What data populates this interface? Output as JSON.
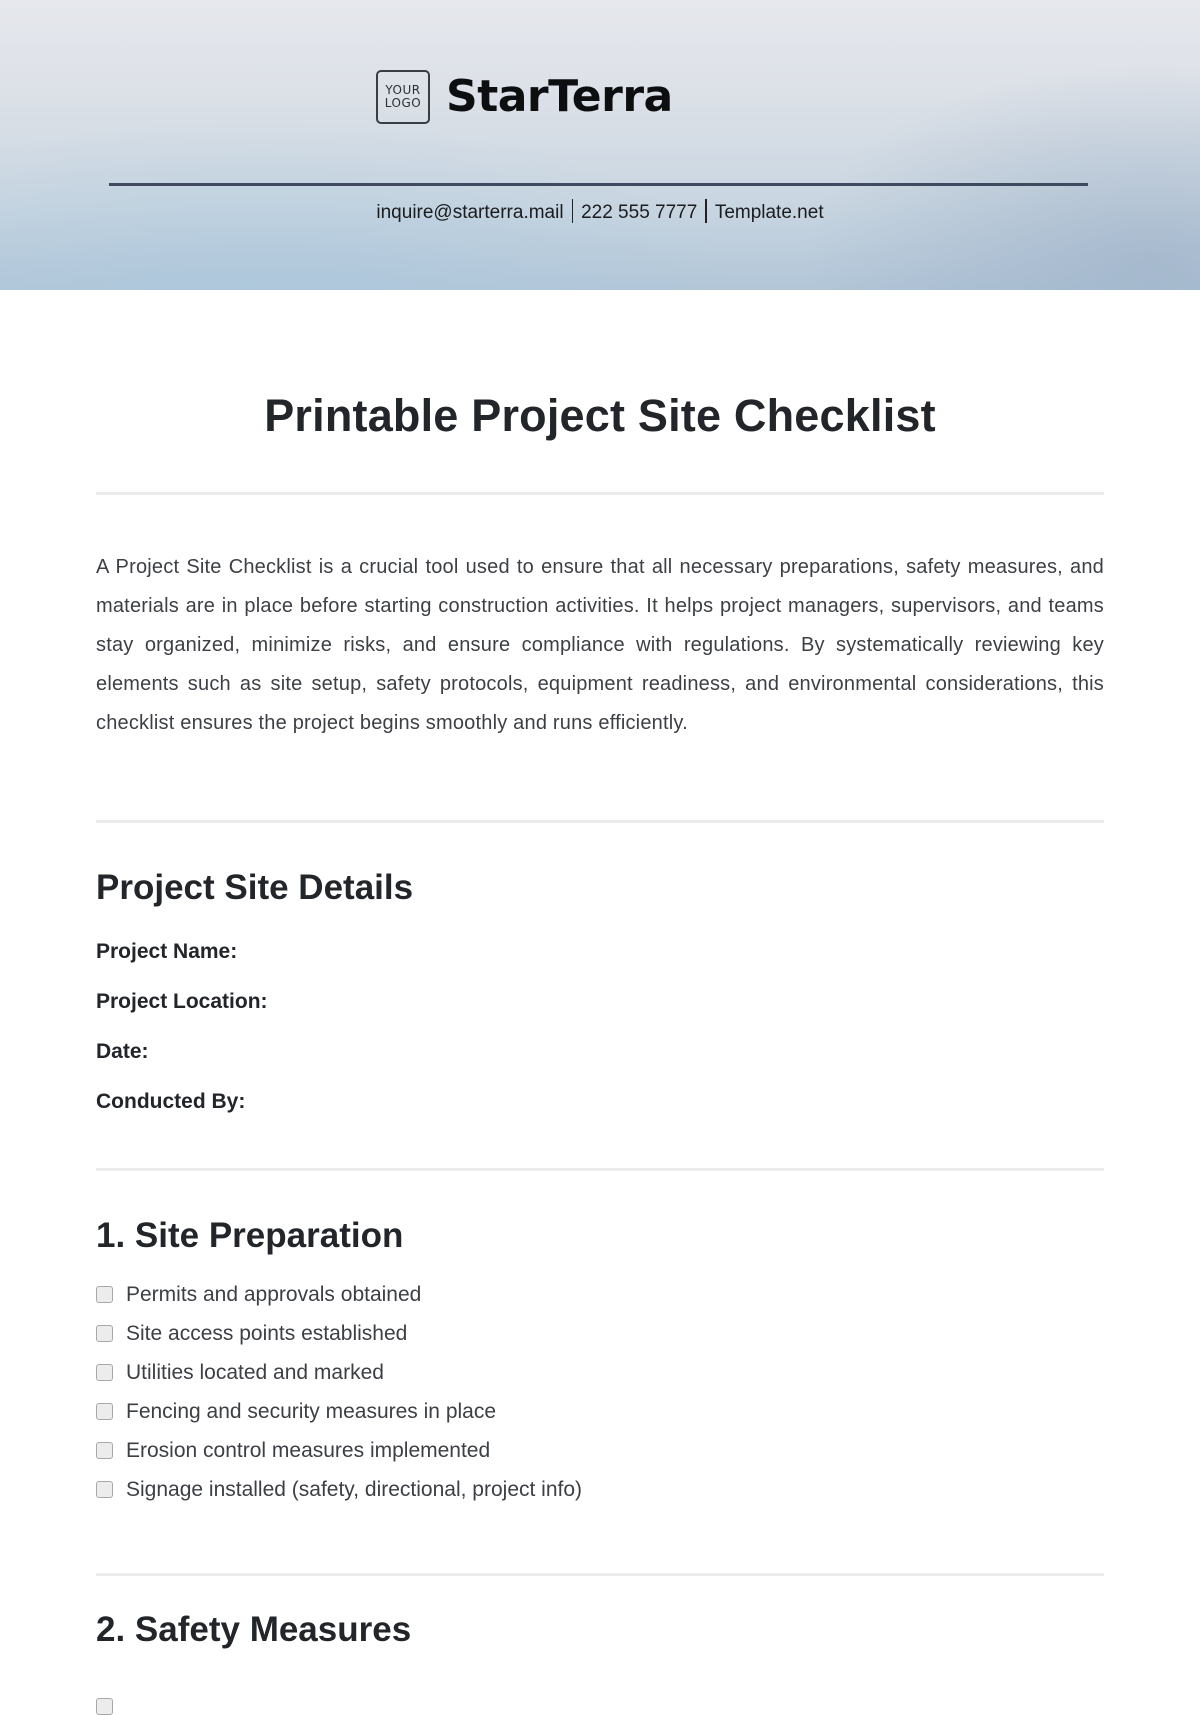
{
  "header": {
    "logo_line1": "YOUR",
    "logo_line2": "LOGO",
    "company_name": "StarTerra",
    "contact": {
      "email": "inquire@starterra.mail",
      "phone": "222 555 7777",
      "website": "Template.net"
    }
  },
  "document": {
    "title": "Printable Project Site Checklist",
    "intro": "A Project Site Checklist is a crucial tool used to ensure that all necessary preparations, safety measures, and materials are in place before starting construction activities. It helps project managers, supervisors, and teams stay organized, minimize risks, and ensure compliance with regulations. By systematically reviewing key elements such as site setup, safety protocols, equipment readiness, and environmental considerations, this checklist ensures the project begins smoothly and runs efficiently."
  },
  "details": {
    "title": "Project Site Details",
    "fields": [
      {
        "label": "Project Name:",
        "value": ""
      },
      {
        "label": "Project Location:",
        "value": ""
      },
      {
        "label": "Date:",
        "value": ""
      },
      {
        "label": "Conducted By:",
        "value": ""
      }
    ]
  },
  "sections": [
    {
      "title": "1. Site Preparation",
      "items": [
        {
          "label": "Permits and approvals obtained",
          "checked": false
        },
        {
          "label": "Site access points established",
          "checked": false
        },
        {
          "label": "Utilities located and marked",
          "checked": false
        },
        {
          "label": "Fencing and security measures in place",
          "checked": false
        },
        {
          "label": "Erosion control measures implemented",
          "checked": false
        },
        {
          "label": "Signage installed (safety, directional, project info)",
          "checked": false
        }
      ]
    },
    {
      "title": "2. Safety Measures",
      "items": []
    }
  ]
}
